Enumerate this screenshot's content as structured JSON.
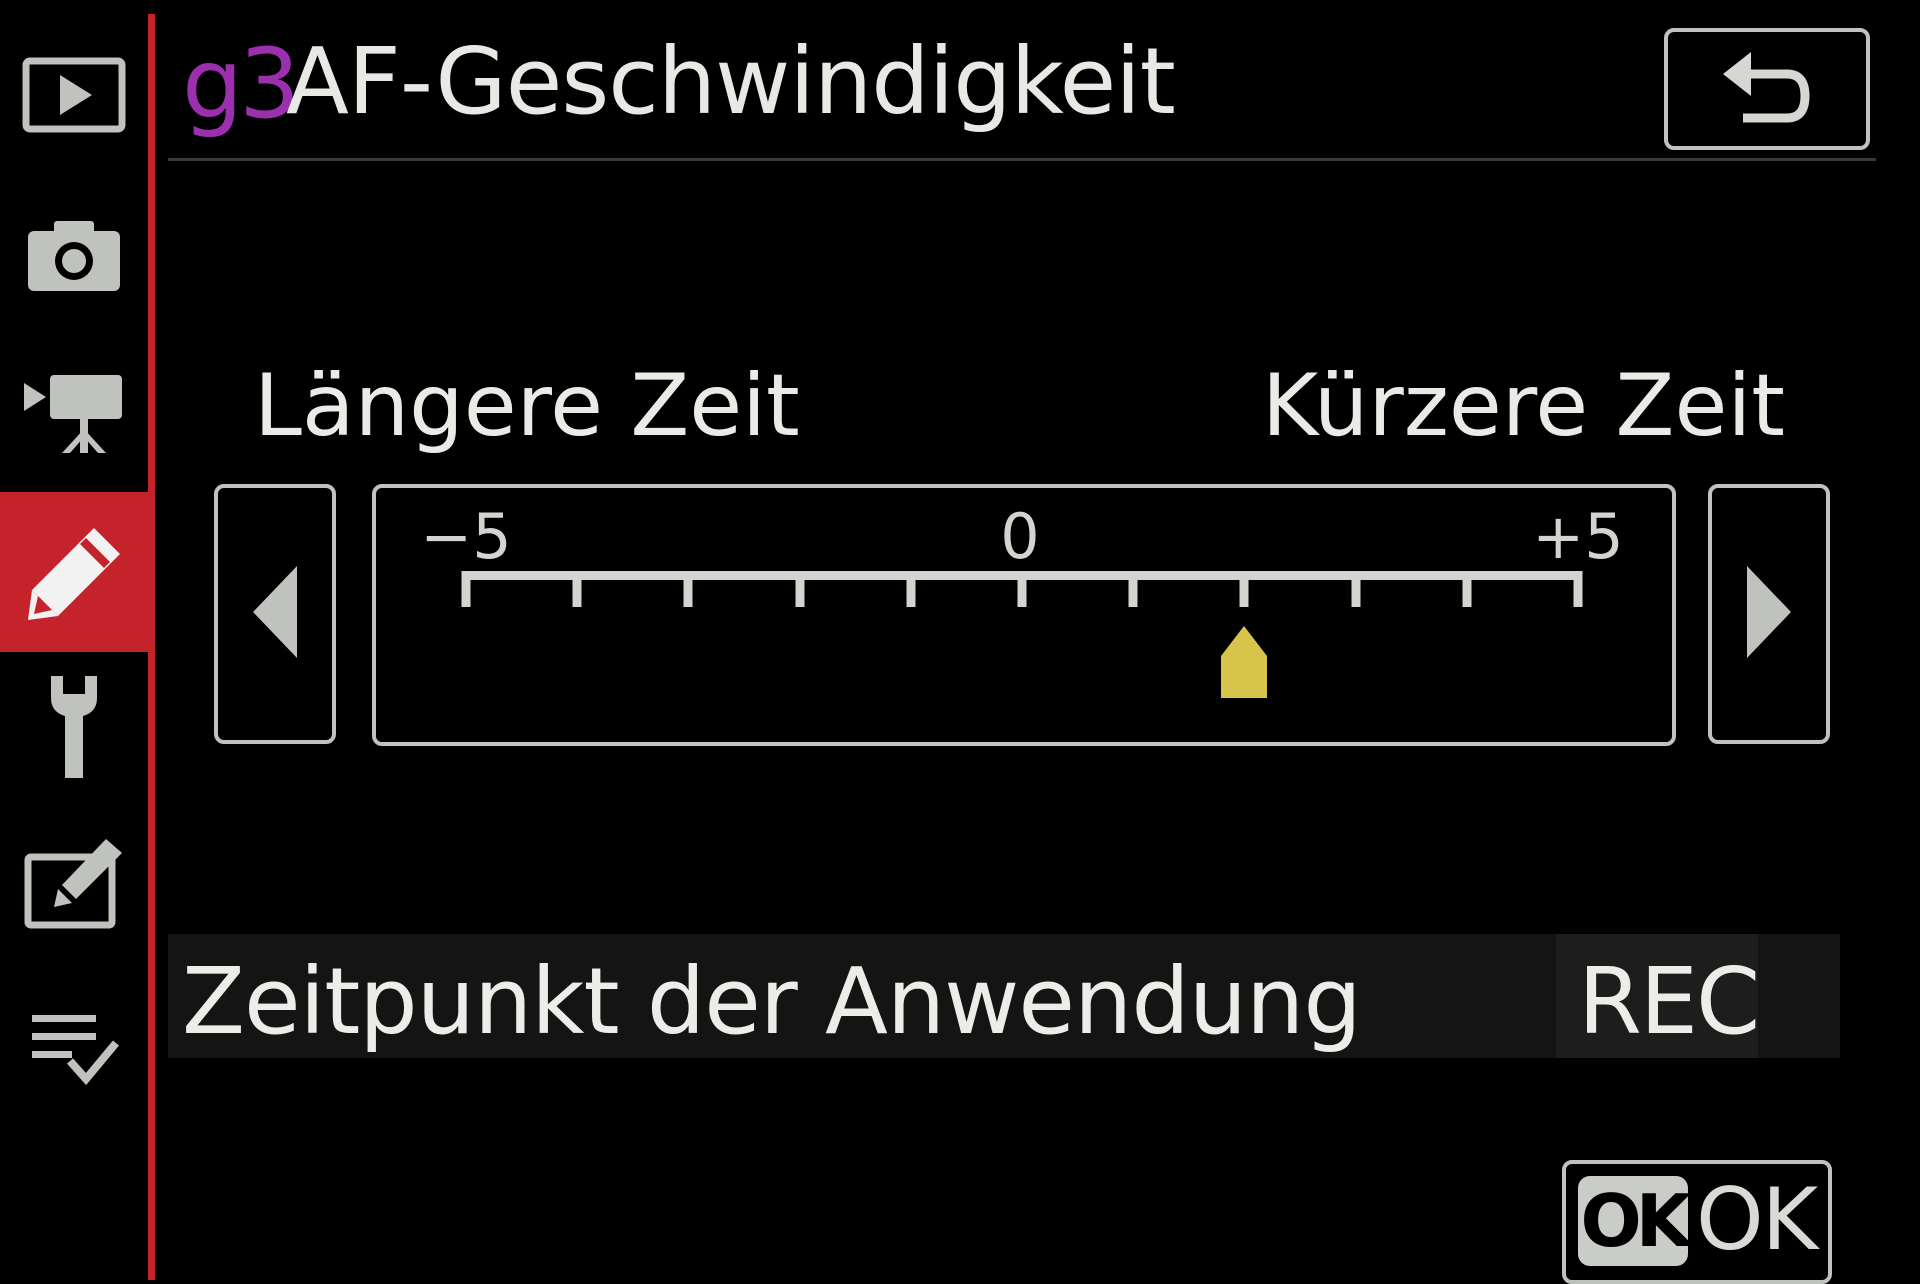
{
  "header": {
    "code": "g3",
    "title": "AF-Geschwindigkeit",
    "back_icon": "return-arrow-icon"
  },
  "sidebar": {
    "items": [
      {
        "icon": "playback-icon",
        "active": false
      },
      {
        "icon": "photo-shooting-icon",
        "active": false
      },
      {
        "icon": "movie-shooting-icon",
        "active": false
      },
      {
        "icon": "custom-settings-pencil-icon",
        "active": true
      },
      {
        "icon": "setup-wrench-icon",
        "active": false
      },
      {
        "icon": "retouch-icon",
        "active": false
      },
      {
        "icon": "my-menu-icon",
        "active": false
      }
    ],
    "accent_color": "#c4232b"
  },
  "slider": {
    "label_left": "Längere Zeit",
    "label_right": "Kürzere Zeit",
    "min_label": "−5",
    "mid_label": "0",
    "max_label": "+5",
    "min": -5,
    "max": 5,
    "value": 2,
    "pointer_color": "#d7c44a"
  },
  "option": {
    "label": "Zeitpunkt der Anwendung",
    "value": "REC"
  },
  "ok": {
    "badge": "OK",
    "label": "OK"
  }
}
